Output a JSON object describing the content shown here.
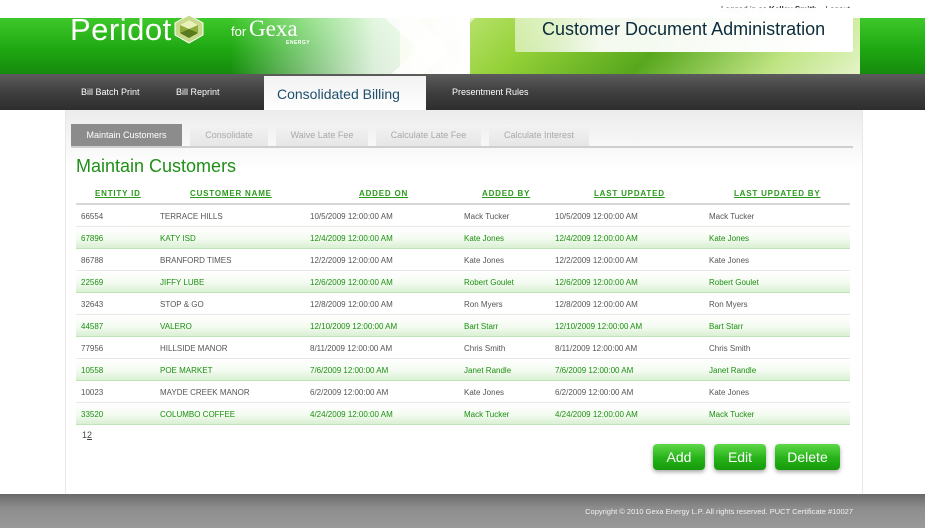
{
  "header": {
    "login_prefix": "Logged in as",
    "user": "Kelley Smith",
    "login_suffix": ".",
    "logout": "Logout",
    "brand": "Peridot",
    "for": "for",
    "partner": "Gexa",
    "partner_sub": "ENERGY",
    "app_title": "Customer Document Administration"
  },
  "nav": {
    "items": [
      {
        "label": "Bill Batch Print"
      },
      {
        "label": "Bill Reprint"
      },
      {
        "label": "Consolidated Billing"
      },
      {
        "label": "Presentment Rules"
      }
    ],
    "active_index": 2
  },
  "subtabs": [
    {
      "label": "Maintain Customers"
    },
    {
      "label": "Consolidate"
    },
    {
      "label": "Waive Late Fee"
    },
    {
      "label": "Calculate Late Fee"
    },
    {
      "label": "Calculate Interest"
    }
  ],
  "section_title": "Maintain Customers",
  "table": {
    "columns": [
      "ENTITY ID",
      "CUSTOMER NAME",
      "ADDED ON",
      "ADDED BY",
      "LAST UPDATED",
      "LAST UPDATED  BY"
    ],
    "rows": [
      [
        "66554",
        "TERRACE HILLS",
        "10/5/2009 12:00:00 AM",
        "Mack Tucker",
        "10/5/2009 12:00:00 AM",
        "Mack Tucker"
      ],
      [
        "67896",
        "KATY ISD",
        "12/4/2009 12:00:00 AM",
        "Kate Jones",
        "12/4/2009 12:00:00 AM",
        "Kate Jones"
      ],
      [
        "86788",
        "BRANFORD TIMES",
        "12/2/2009 12:00:00 AM",
        "Kate Jones",
        "12/2/2009 12:00:00 AM",
        "Kate Jones"
      ],
      [
        "22569",
        "JIFFY LUBE",
        "12/6/2009 12:00:00 AM",
        "Robert Goulet",
        "12/6/2009 12:00:00 AM",
        "Robert Goulet"
      ],
      [
        "32643",
        "STOP & GO",
        "12/8/2009 12:00:00 AM",
        "Ron Myers",
        "12/8/2009 12:00:00 AM",
        "Ron Myers"
      ],
      [
        "44587",
        "VALERO",
        "12/10/2009 12:00:00 AM",
        "Bart Starr",
        "12/10/2009 12:00:00 AM",
        "Bart Starr"
      ],
      [
        "77956",
        "HILLSIDE MANOR",
        "8/11/2009 12:00:00 AM",
        "Chris Smith",
        "8/11/2009 12:00:00 AM",
        "Chris Smith"
      ],
      [
        "10558",
        "POE MARKET",
        "7/6/2009 12:00:00 AM",
        "Janet Randle",
        "7/6/2009 12:00:00 AM",
        "Janet Randle"
      ],
      [
        "10023",
        "MAYDE CREEK MANOR",
        "6/2/2009 12:00:00 AM",
        "Kate Jones",
        "6/2/2009 12:00:00 AM",
        "Kate Jones"
      ],
      [
        "33520",
        "COLUMBO COFFEE",
        "4/24/2009 12:00:00 AM",
        "Mack Tucker",
        "4/24/2009 12:00:00 AM",
        "Mack Tucker"
      ]
    ]
  },
  "pager": {
    "page1": "1",
    "page2": "2"
  },
  "buttons": {
    "add": "Add",
    "edit": "Edit",
    "delete": "Delete"
  },
  "footer": {
    "copyright": "Copyright © 2010 Gexa Energy L.P. All rights reserved. PUCT Certificate #10027"
  },
  "colors": {
    "brand_green": "#1fa812",
    "row_green_text": "#1b8f11",
    "nav_dark": "#3f3f3f",
    "title_navy": "#0d2c3b"
  },
  "icons": {
    "logo_gem": "peridot-gem-icon"
  }
}
